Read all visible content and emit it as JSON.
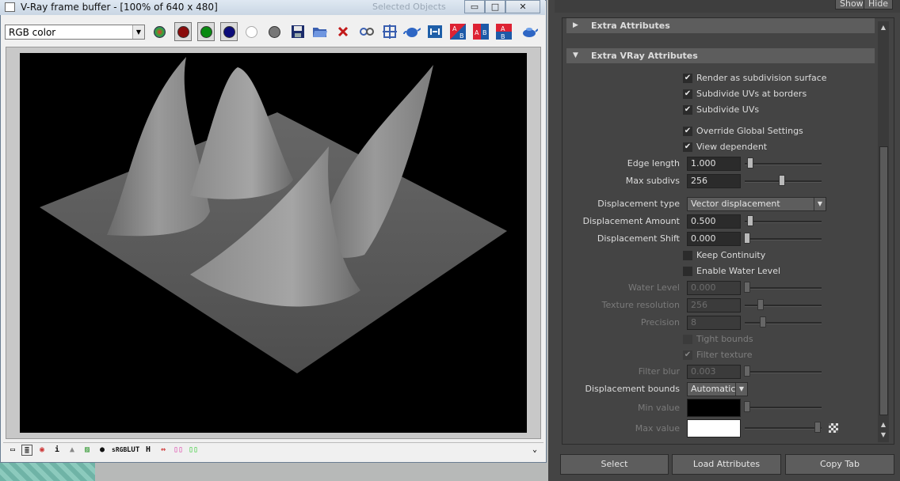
{
  "vfb": {
    "title": "V-Ray frame buffer - [100% of 640 x 480]",
    "ghost_text": "Selected Objects",
    "channel": "RGB color",
    "window_buttons": {
      "minimize": "▭",
      "maximize": "□",
      "close": "✕"
    },
    "toolbar_icons": [
      "rgb-channels-icon",
      "red-channel-icon",
      "green-channel-icon",
      "blue-channel-icon",
      "alpha-channel-icon",
      "monochrome-icon",
      "save-image-icon",
      "load-image-icon",
      "clear-image-icon",
      "track-mouse-icon",
      "region-render-icon",
      "render-teapot-icon",
      "link-to-vfb-icon",
      "compare-ab-horizontal-icon",
      "compare-ab-icon",
      "compare-ab-vertical-icon",
      "render-icon"
    ],
    "bottom_icons": [
      "show-corrections-icon",
      "levels-icon",
      "curve-icon",
      "info-icon",
      "background-icon",
      "color-clamp-icon",
      "srgb-icon",
      "lut-icon",
      "histogram-icon",
      "pixel-aspect-icon",
      "stereo-red-icon",
      "stereo-green-icon"
    ],
    "bottom_labels": {
      "info": "i",
      "srgb": "sRGB",
      "lut": "LUT",
      "hist": "H"
    },
    "expand_label": "⌄"
  },
  "ae": {
    "top_buttons": {
      "show": "Show",
      "hide": "Hide"
    },
    "sections": {
      "extra": "Extra Attributes",
      "vray": "Extra VRay Attributes"
    },
    "checkboxes": {
      "render_subdiv": {
        "label": "Render as subdivision surface",
        "checked": true
      },
      "subdiv_uv_borders": {
        "label": "Subdivide UVs at borders",
        "checked": true
      },
      "subdiv_uvs": {
        "label": "Subdivide UVs",
        "checked": true
      },
      "override_global": {
        "label": "Override Global Settings",
        "checked": true
      },
      "view_dependent": {
        "label": "View dependent",
        "checked": true
      },
      "keep_continuity": {
        "label": "Keep Continuity",
        "checked": false
      },
      "enable_water": {
        "label": "Enable Water Level",
        "checked": false
      },
      "tight_bounds": {
        "label": "Tight bounds",
        "checked": false
      },
      "filter_texture": {
        "label": "Filter texture",
        "checked": true
      }
    },
    "fields": {
      "edge_length": {
        "label": "Edge length",
        "value": "1.000",
        "slider": 0.05
      },
      "max_subdivs": {
        "label": "Max subdivs",
        "value": "256",
        "slider": 0.5
      },
      "disp_amount": {
        "label": "Displacement Amount",
        "value": "0.500",
        "slider": 0.05
      },
      "disp_shift": {
        "label": "Displacement Shift",
        "value": "0.000",
        "slider": 0.0
      },
      "water_level": {
        "label": "Water Level",
        "value": "0.000",
        "slider": 0.0
      },
      "texture_res": {
        "label": "Texture resolution",
        "value": "256",
        "slider": 0.2
      },
      "precision": {
        "label": "Precision",
        "value": "8",
        "slider": 0.23
      },
      "filter_blur": {
        "label": "Filter blur",
        "value": "0.003",
        "slider": 0.0
      },
      "min_value": {
        "label": "Min value",
        "slider": 0.0,
        "color": "#000000"
      },
      "max_value": {
        "label": "Max value",
        "slider": 0.95,
        "color": "#ffffff"
      }
    },
    "disp_type": {
      "label": "Displacement type",
      "value": "Vector displacement"
    },
    "disp_bounds": {
      "label": "Displacement bounds",
      "value": "Automatic"
    },
    "bottom_buttons": {
      "select": "Select",
      "load": "Load Attributes",
      "copy": "Copy Tab"
    }
  }
}
